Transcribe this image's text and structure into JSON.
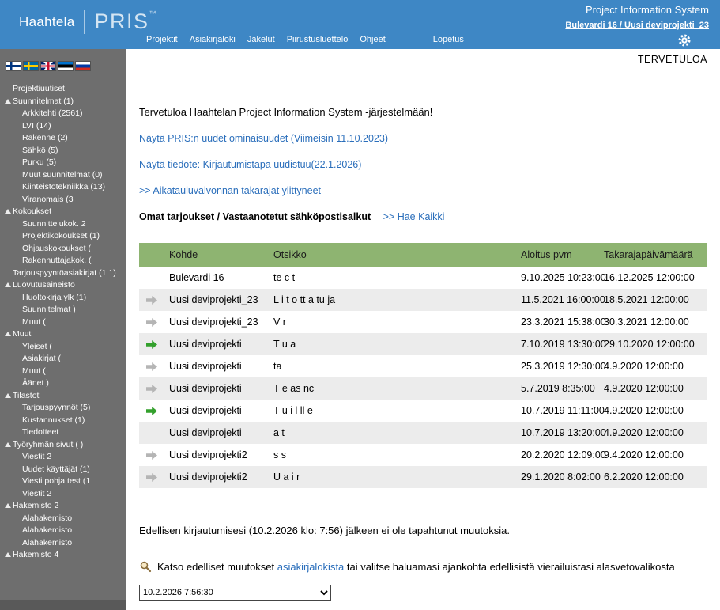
{
  "header": {
    "brand": "Haahtela",
    "product": "PRIS",
    "trademark": "™",
    "system_title": "Project Information System",
    "project_link": "Bulevardi 16 /  Uusi deviprojekti_23",
    "nav": [
      {
        "id": "projektit",
        "label": "Projektit"
      },
      {
        "id": "asiakirjaloki",
        "label": "Asiakirjaloki"
      },
      {
        "id": "jakelut",
        "label": "Jakelut"
      },
      {
        "id": "piirustusluettelo",
        "label": "Piirustusluettelo"
      },
      {
        "id": "ohjeet",
        "label": "Ohjeet"
      },
      {
        "id": "lopetus",
        "label": "Lopetus",
        "gap": true
      }
    ],
    "icons": {
      "settings": "gear-icon"
    }
  },
  "sidebar": {
    "flags": [
      {
        "code": "fi",
        "name": "finnish-flag-icon"
      },
      {
        "code": "sv",
        "name": "swedish-flag-icon"
      },
      {
        "code": "en",
        "name": "british-flag-icon"
      },
      {
        "code": "et",
        "name": "estonian-flag-icon"
      },
      {
        "code": "ru",
        "name": "russian-flag-icon"
      }
    ],
    "tree": [
      {
        "label": "Projektiuutiset",
        "level": 0,
        "expandable": false
      },
      {
        "label": "Suunnitelmat (1)",
        "level": 0,
        "expandable": true
      },
      {
        "label": "Arkkitehti (2561)",
        "level": 1,
        "expandable": false
      },
      {
        "label": "LVI (14)",
        "level": 1,
        "expandable": false
      },
      {
        "label": "Rakenne (2)",
        "level": 1,
        "expandable": false
      },
      {
        "label": "Sähkö (5)",
        "level": 1,
        "expandable": false
      },
      {
        "label": "Purku (5)",
        "level": 1,
        "expandable": false
      },
      {
        "label": "Muut suunnitelmat (0)",
        "level": 1,
        "expandable": false
      },
      {
        "label": "Kiinteistötekniikka (13)",
        "level": 1,
        "expandable": false
      },
      {
        "label": "Viranomais (3",
        "level": 1,
        "expandable": false
      },
      {
        "label": "Kokoukset",
        "level": 0,
        "expandable": true
      },
      {
        "label": "Suunnittelukok. 2",
        "level": 1,
        "expandable": false
      },
      {
        "label": "Projektikokoukset (1)",
        "level": 1,
        "expandable": false
      },
      {
        "label": "Ohjauskokoukset (",
        "level": 1,
        "expandable": false
      },
      {
        "label": "Rakennuttajakok. (",
        "level": 1,
        "expandable": false
      },
      {
        "label": "Tarjouspyyntöasiakirjat (1 1)",
        "level": 0,
        "expandable": false
      },
      {
        "label": "Luovutusaineisto",
        "level": 0,
        "expandable": true
      },
      {
        "label": "Huoltokirja ylk (1)",
        "level": 1,
        "expandable": false
      },
      {
        "label": "Suunnitelmat )",
        "level": 1,
        "expandable": false
      },
      {
        "label": "Muut (",
        "level": 1,
        "expandable": false
      },
      {
        "label": "Muut",
        "level": 0,
        "expandable": true
      },
      {
        "label": "Yleiset (",
        "level": 1,
        "expandable": false
      },
      {
        "label": "Asiakirjat (",
        "level": 1,
        "expandable": false
      },
      {
        "label": "Muut (",
        "level": 1,
        "expandable": false
      },
      {
        "label": "Äänet )",
        "level": 1,
        "expandable": false
      },
      {
        "label": "Tilastot",
        "level": 0,
        "expandable": true
      },
      {
        "label": "Tarjouspyynnöt (5)",
        "level": 1,
        "expandable": false
      },
      {
        "label": "Kustannukset (1)",
        "level": 1,
        "expandable": false
      },
      {
        "label": "Tiedotteet",
        "level": 1,
        "expandable": false
      },
      {
        "label": "Työryhmän sivut ( )",
        "level": 0,
        "expandable": true
      },
      {
        "label": "Viestit 2",
        "level": 1,
        "expandable": false
      },
      {
        "label": "Uudet käyttäjät (1)",
        "level": 1,
        "expandable": false
      },
      {
        "label": "Viesti pohja test (1",
        "level": 1,
        "expandable": false
      },
      {
        "label": "Viestit 2",
        "level": 1,
        "expandable": false
      },
      {
        "label": "Hakemisto 2",
        "level": 0,
        "expandable": true
      },
      {
        "label": "Alahakemisto",
        "level": 1,
        "expandable": false
      },
      {
        "label": "Alahakemisto",
        "level": 1,
        "expandable": false
      },
      {
        "label": "Alahakemisto",
        "level": 1,
        "expandable": false
      },
      {
        "label": "Hakemisto 4",
        "level": 0,
        "expandable": true
      }
    ]
  },
  "main": {
    "welcome_label": "TERVETULOA",
    "welcome_text": "Tervetuloa Haahtelan Project Information System -järjestelmään!",
    "links": [
      {
        "text": "Näytä PRIS:n uudet ominaisuudet (Viimeisin 11.10.2023)"
      },
      {
        "text": "Näytä tiedote: Kirjautumistapa uudistuu(22.1.2026)"
      },
      {
        "text": ">> Aikatauluvalvonnan takarajat ylittyneet"
      }
    ],
    "offers_heading": "Omat tarjoukset / Vastaanotetut sähköpostisalkut",
    "search_all_link": ">> Hae Kaikki",
    "table": {
      "columns": [
        "Kohde",
        "Otsikko",
        "Aloitus pvm",
        "Takarajapäivämäärä"
      ],
      "rows": [
        {
          "arrow": "none",
          "kohde": "Bulevardi 16",
          "otsikko": "te c t",
          "aloitus": "9.10.2025 10:23:00",
          "takaraja": "16.12.2025 12:00:00"
        },
        {
          "arrow": "gray",
          "kohde": "Uusi deviprojekti_23",
          "otsikko": "L i t o tt a tu ja",
          "aloitus": "11.5.2021 16:00:00",
          "takaraja": "18.5.2021 12:00:00"
        },
        {
          "arrow": "gray",
          "kohde": "Uusi deviprojekti_23",
          "otsikko": "V r",
          "aloitus": "23.3.2021 15:38:00",
          "takaraja": "30.3.2021 12:00:00"
        },
        {
          "arrow": "green",
          "kohde": "Uusi deviprojekti",
          "otsikko": "T u a",
          "aloitus": "7.10.2019 13:30:00",
          "takaraja": "29.10.2020 12:00:00"
        },
        {
          "arrow": "gray",
          "kohde": "Uusi deviprojekti",
          "otsikko": "ta",
          "aloitus": "25.3.2019 12:30:00",
          "takaraja": "4.9.2020 12:00:00"
        },
        {
          "arrow": "gray",
          "kohde": "Uusi deviprojekti",
          "otsikko": "T e as nc",
          "aloitus": "5.7.2019 8:35:00",
          "takaraja": "4.9.2020 12:00:00"
        },
        {
          "arrow": "green",
          "kohde": "Uusi deviprojekti",
          "otsikko": "T u i l ll e",
          "aloitus": "10.7.2019 11:11:00",
          "takaraja": "4.9.2020 12:00:00"
        },
        {
          "arrow": "none",
          "kohde": "Uusi deviprojekti",
          "otsikko": "a t",
          "aloitus": "10.7.2019 13:20:00",
          "takaraja": "4.9.2020 12:00:00"
        },
        {
          "arrow": "gray",
          "kohde": "Uusi deviprojekti2",
          "otsikko": "s s",
          "aloitus": "20.2.2020 12:09:00",
          "takaraja": "9.4.2020 12:00:00"
        },
        {
          "arrow": "gray",
          "kohde": "Uusi deviprojekti2",
          "otsikko": "U a i r",
          "aloitus": "29.1.2020 8:02:00",
          "takaraja": "6.2.2020 12:00:00"
        }
      ]
    },
    "last_login_text": "Edellisen kirjautumisesi (10.2.2026 klo: 7:56) jälkeen ei ole tapahtunut muutoksia.",
    "changes": {
      "prefix": "Katso edelliset muutokset ",
      "link_text": "asiakirjalokista",
      "suffix": " tai valitse haluamasi ajankohta edellisistä vierailuistasi alasvetovalikosta"
    },
    "login_select": {
      "value": "10.2.2026 7:56:30"
    }
  },
  "colors": {
    "header_blue": "#3e87c5",
    "sidebar_gray": "#6e6e6e",
    "table_header_green": "#8eb471",
    "deadline_red": "#cc3300",
    "link_blue": "#2a6ebb",
    "arrow_green": "#33a02c",
    "arrow_gray": "#b5b5b5"
  }
}
